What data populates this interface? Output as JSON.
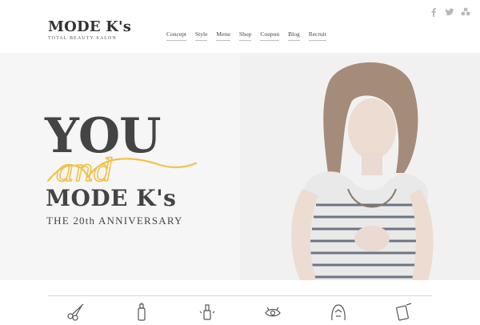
{
  "header": {
    "logo_main": "MODE K's",
    "logo_sub": "TOTAL BEAUTY SALON",
    "nav": [
      "Concept",
      "Style",
      "Menu",
      "Shop",
      "Coupon",
      "Blog",
      "Recruit"
    ],
    "social_icons": [
      "facebook-icon",
      "twitter-icon",
      "share-icon"
    ]
  },
  "hero": {
    "word_you": "YOU",
    "word_and": "and",
    "word_modeks": "MODE K's",
    "anniversary": "THE 20th ANNIVERSARY"
  },
  "colors": {
    "text": "#444444",
    "accent": "#f0c24a",
    "hero_bg": "#f6f6f6"
  },
  "bottom_icons": [
    "scissors-icon",
    "bottle-icon",
    "nail-polish-icon",
    "eye-makeup-icon",
    "face-icon",
    "mirror-icon"
  ]
}
